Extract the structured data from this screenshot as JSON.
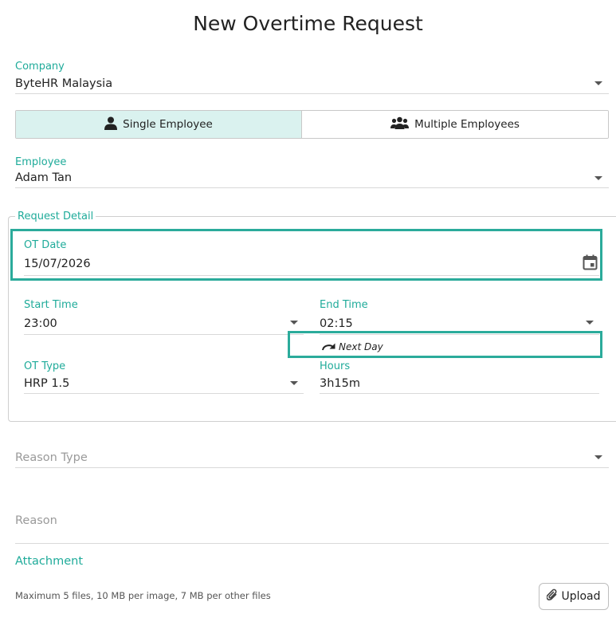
{
  "page_title": "New Overtime Request",
  "company": {
    "label": "Company",
    "value": "ByteHR Malaysia"
  },
  "mode_toggle": {
    "single_label": "Single Employee",
    "multiple_label": "Multiple Employees",
    "selected": "single"
  },
  "employee": {
    "label": "Employee",
    "value": "Adam Tan"
  },
  "request_detail": {
    "legend": "Request Detail",
    "ot_date": {
      "label": "OT Date",
      "value": "15/07/2026"
    },
    "start_time": {
      "label": "Start Time",
      "value": "23:00"
    },
    "end_time": {
      "label": "End Time",
      "value": "02:15"
    },
    "next_day_label": "Next Day",
    "ot_type": {
      "label": "OT Type",
      "value": "HRP 1.5"
    },
    "hours": {
      "label": "Hours",
      "value": "3h15m"
    }
  },
  "reason_type": {
    "placeholder": "Reason Type"
  },
  "reason": {
    "placeholder": "Reason"
  },
  "attachment": {
    "title": "Attachment",
    "hint": "Maximum 5 files, 10 MB per image, 7 MB per other files",
    "upload_label": "Upload"
  },
  "colors": {
    "accent": "#1fab9a",
    "highlight": "#2bab9b",
    "selected_bg": "#daf2ef"
  },
  "icons": [
    "person-icon",
    "group-icon",
    "calendar-icon",
    "redo-arrow-icon",
    "paperclip-icon",
    "dropdown-caret-icon"
  ]
}
